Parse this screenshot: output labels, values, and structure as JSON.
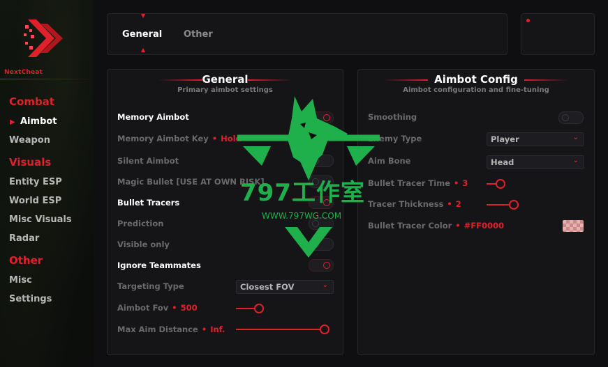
{
  "sidebar": {
    "brand": "NextCheat",
    "sections": [
      {
        "label": "Combat",
        "items": [
          {
            "label": "Aimbot",
            "active": true
          },
          {
            "label": "Weapon"
          }
        ]
      },
      {
        "label": "Visuals",
        "items": [
          {
            "label": "Entity ESP"
          },
          {
            "label": "World ESP"
          },
          {
            "label": "Misc Visuals"
          },
          {
            "label": "Radar"
          }
        ]
      },
      {
        "label": "Other",
        "items": [
          {
            "label": "Misc"
          },
          {
            "label": "Settings"
          }
        ]
      }
    ]
  },
  "topbar": {
    "tabs": [
      {
        "label": "General",
        "active": true
      },
      {
        "label": "Other"
      }
    ]
  },
  "panels": {
    "general": {
      "title": "General",
      "subtitle": "Primary aimbot settings",
      "rows": {
        "memory_aimbot": {
          "label": "Memory Aimbot",
          "on": true
        },
        "memory_aimbot_key": {
          "label": "Memory Aimbot Key",
          "value": "Hold"
        },
        "silent_aimbot": {
          "label": "Silent Aimbot",
          "on": false
        },
        "magic_bullet": {
          "label": "Magic Bullet [USE AT OWN RISK]",
          "on": false
        },
        "bullet_tracers": {
          "label": "Bullet Tracers",
          "on": true
        },
        "prediction": {
          "label": "Prediction",
          "on": false
        },
        "visible_only": {
          "label": "Visible only",
          "on": false
        },
        "ignore_teammates": {
          "label": "Ignore Teammates",
          "on": true
        },
        "targeting_type": {
          "label": "Targeting Type",
          "value": "Closest FOV"
        },
        "aimbot_fov": {
          "label": "Aimbot Fov",
          "value": "500",
          "fraction": 0.25
        },
        "max_aim_distance": {
          "label": "Max Aim Distance",
          "value": "Inf.",
          "fraction": 1.0
        }
      }
    },
    "aimbot_config": {
      "title": "Aimbot Config",
      "subtitle": "Aimbot configuration and fine-tuning",
      "rows": {
        "smoothing": {
          "label": "Smoothing",
          "on": false
        },
        "enemy_type": {
          "label": "Enemy Type",
          "value": "Player"
        },
        "aim_bone": {
          "label": "Aim Bone",
          "value": "Head"
        },
        "bullet_tracer_time": {
          "label": "Bullet Tracer Time",
          "value": "3",
          "fraction": 0.15
        },
        "tracer_thickness": {
          "label": "Tracer Thickness",
          "value": "2",
          "fraction": 0.3
        },
        "bullet_tracer_color": {
          "label": "Bullet Tracer Color",
          "value": "#FF0000"
        }
      }
    }
  },
  "watermark": {
    "title": "797工作室",
    "url": "WWW.797WG.COM"
  },
  "colors": {
    "accent": "#e0202a",
    "background": "#0f0f11",
    "panel": "#151518",
    "watermark": "#1fb04b"
  }
}
